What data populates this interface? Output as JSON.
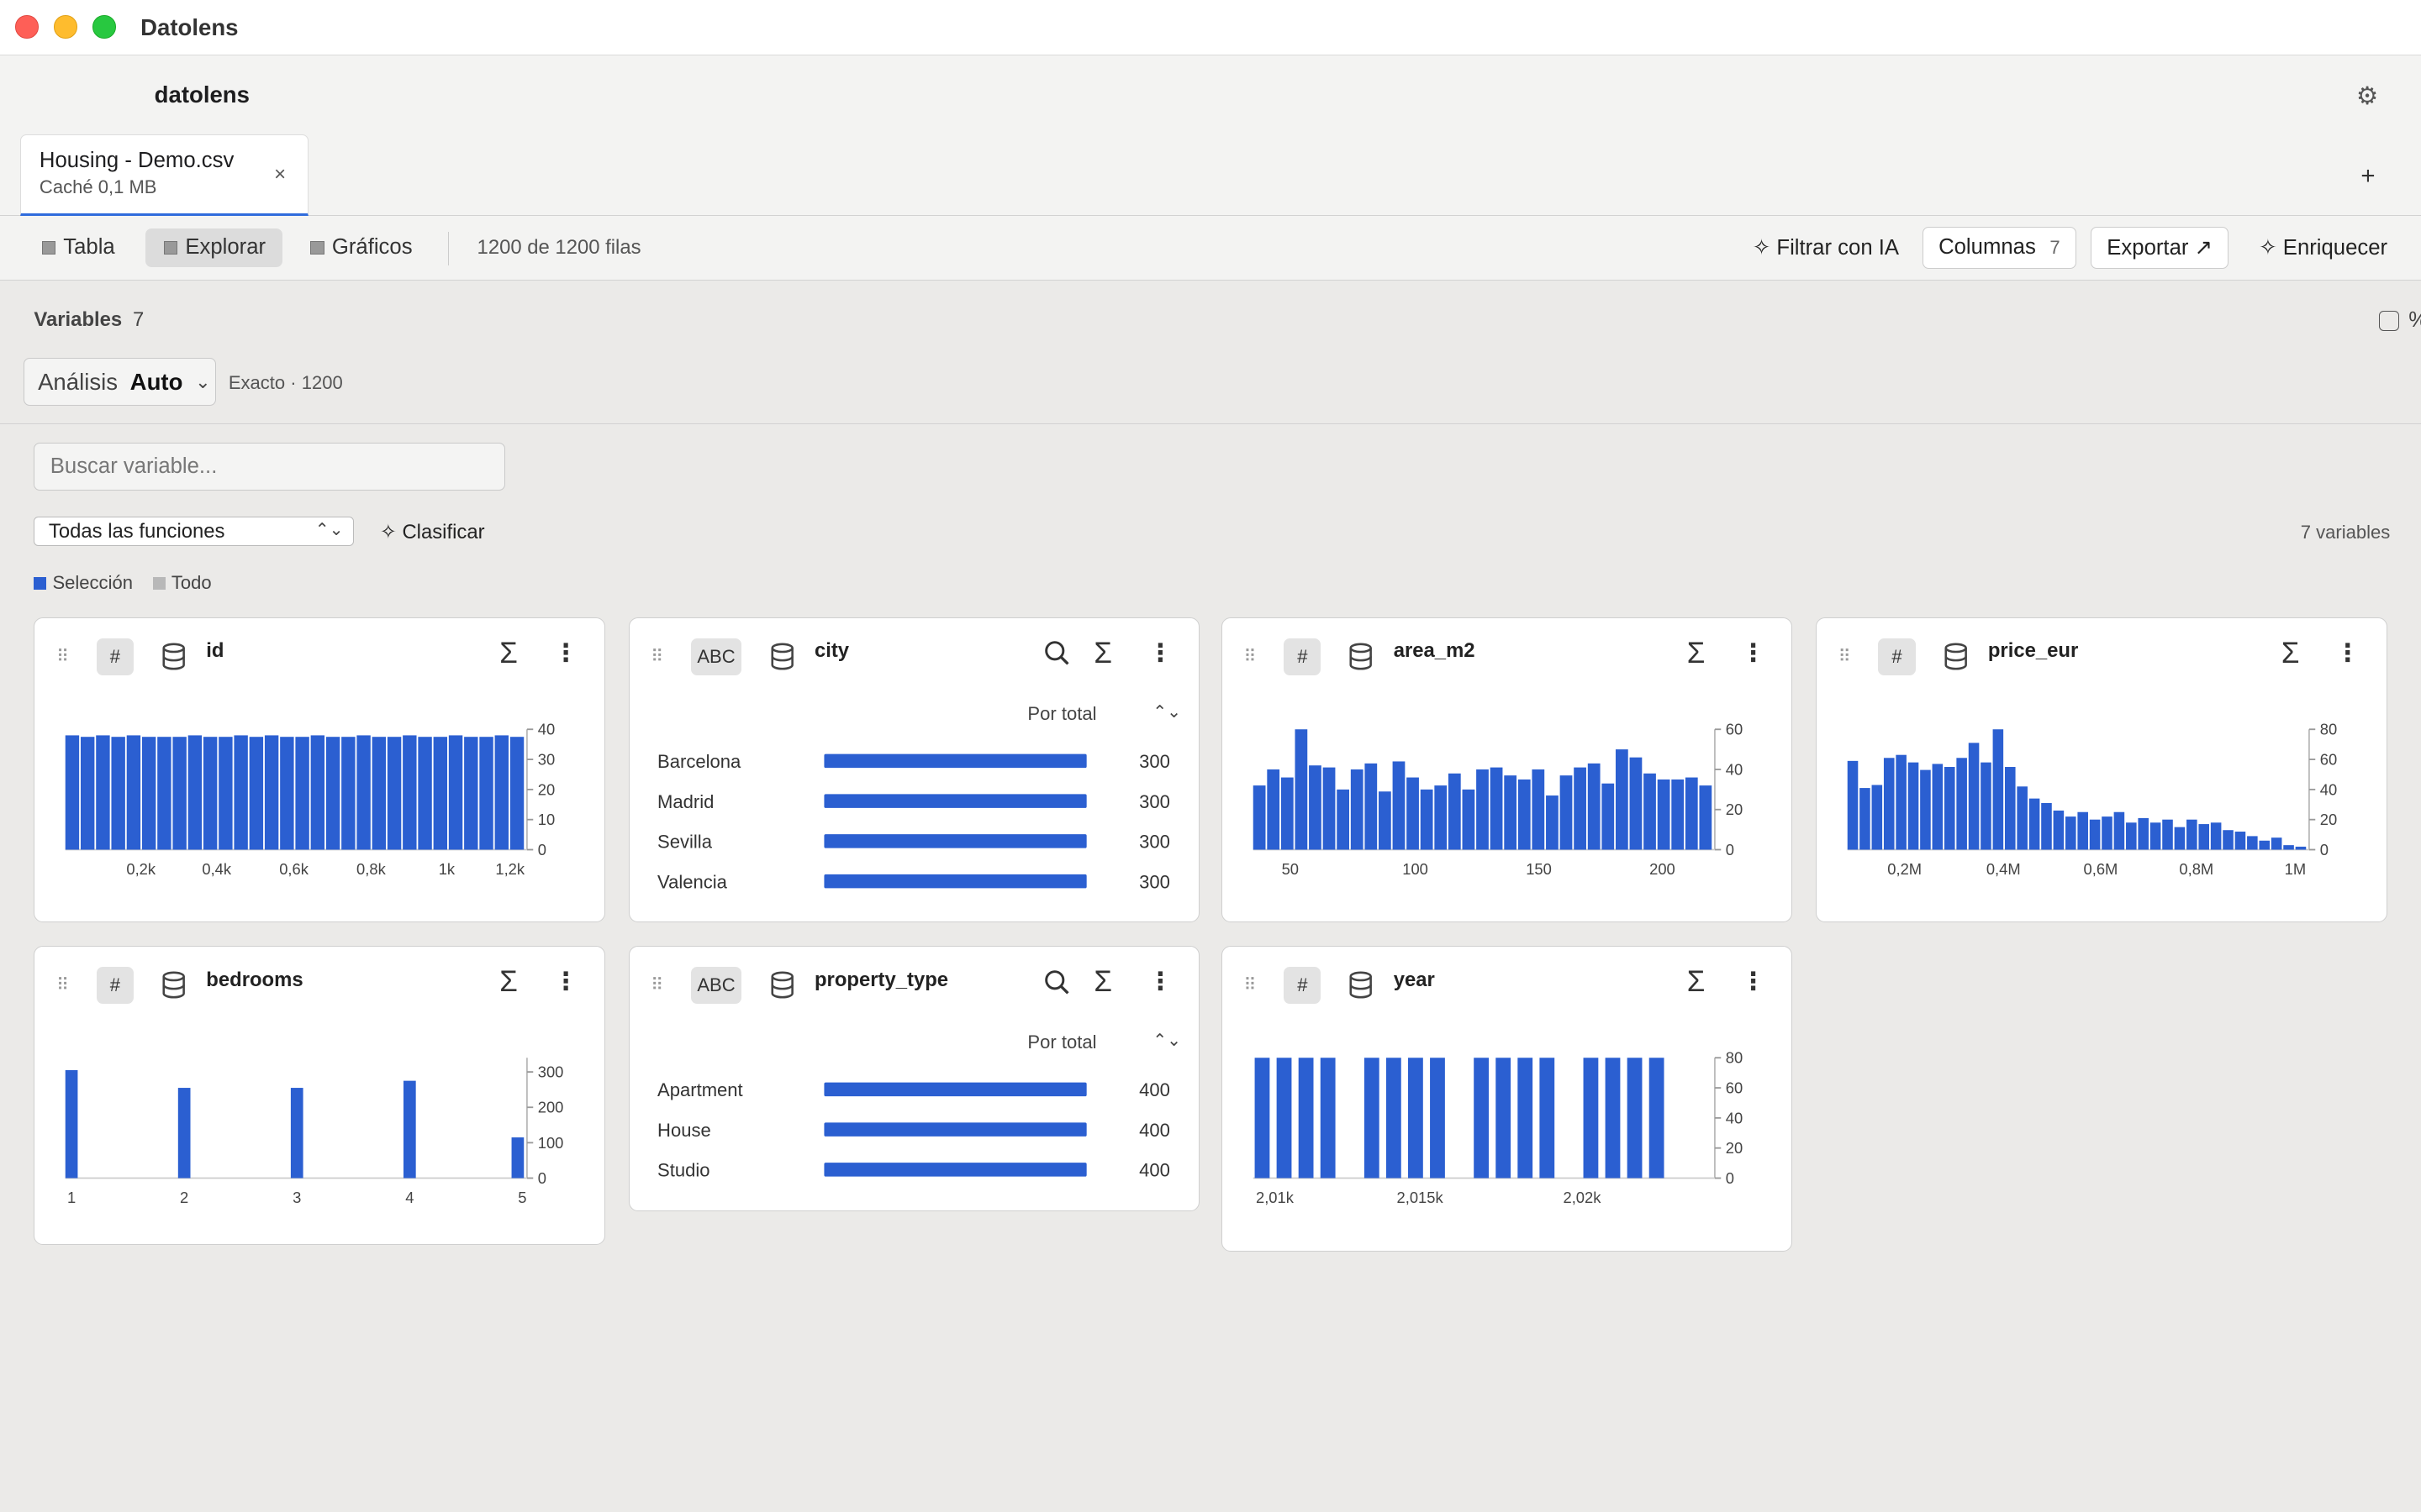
{
  "window": {
    "title": "Datolens"
  },
  "app": {
    "brand": "datolens",
    "settings_icon": "gear-icon"
  },
  "tab": {
    "name": "Housing - Demo.csv",
    "subtitle": "Caché 0,1 MB",
    "close": "×",
    "add": "+"
  },
  "toolbar": {
    "views": [
      "Tabla",
      "Explorar",
      "Gráficos"
    ],
    "active_view": "Explorar",
    "rows": "1200 de 1200 filas",
    "filter_ai": "✧ Filtrar con IA",
    "columns": "Columnas",
    "columns_count": "7",
    "export": "Exportar ↗",
    "enrich": "✧ Enriquecer"
  },
  "variables": {
    "label": "Variables",
    "count": "7",
    "percent_label": "%",
    "analysis_label": "Análisis",
    "analysis_value": "Auto",
    "exact": "Exacto · 1200",
    "search_placeholder": "Buscar variable...",
    "function_select": "Todas las funciones",
    "classify": "✧ Clasificar",
    "total": "7 variables",
    "legend": {
      "selection": "Selección",
      "all": "Todo"
    }
  },
  "colors": {
    "accent": "#2b5fd1",
    "bar": "#2b5fd1",
    "muted": "#b8b8b8"
  },
  "cards": [
    {
      "name": "id",
      "type": "#",
      "kind": "histogram"
    },
    {
      "name": "city",
      "type": "ABC",
      "kind": "categorical",
      "sort": "Por total"
    },
    {
      "name": "area_m2",
      "type": "#",
      "kind": "histogram"
    },
    {
      "name": "price_eur",
      "type": "#",
      "kind": "histogram"
    },
    {
      "name": "bedrooms",
      "type": "#",
      "kind": "histogram"
    },
    {
      "name": "property_type",
      "type": "ABC",
      "kind": "categorical",
      "sort": "Por total"
    },
    {
      "name": "year",
      "type": "#",
      "kind": "histogram"
    }
  ],
  "chart_data": [
    {
      "type": "bar",
      "variable": "id",
      "values": [
        38,
        37.5,
        38,
        37.5,
        38,
        37.5,
        37.5,
        37.5,
        38,
        37.5,
        37.5,
        38,
        37.5,
        38,
        37.5,
        37.5,
        38,
        37.5,
        37.5,
        38,
        37.5,
        37.5,
        38,
        37.5,
        37.5,
        38,
        37.5,
        37.5,
        38,
        37.5
      ],
      "x_ticks": [
        "0,2k",
        "0,4k",
        "0,6k",
        "0,8k",
        "1k",
        "1,2k"
      ],
      "y_ticks": [
        "0",
        "10",
        "20",
        "30",
        "40"
      ],
      "ylim": [
        0,
        40
      ]
    },
    {
      "type": "bar",
      "variable": "city",
      "categories": [
        "Barcelona",
        "Madrid",
        "Sevilla",
        "Valencia"
      ],
      "values": [
        300,
        300,
        300,
        300
      ]
    },
    {
      "type": "bar",
      "variable": "area_m2",
      "values": [
        32,
        40,
        36,
        60,
        42,
        41,
        30,
        40,
        43,
        29,
        44,
        36,
        30,
        32,
        38,
        30,
        40,
        41,
        37,
        35,
        40,
        27,
        37,
        41,
        43,
        33,
        50,
        46,
        38,
        35,
        35,
        36,
        32
      ],
      "x_ticks": [
        "50",
        "100",
        "150",
        "200"
      ],
      "y_ticks": [
        "0",
        "20",
        "40",
        "60"
      ],
      "ylim": [
        0,
        60
      ]
    },
    {
      "type": "bar",
      "variable": "price_eur",
      "values": [
        59,
        41,
        43,
        61,
        63,
        58,
        53,
        57,
        55,
        61,
        71,
        58,
        80,
        55,
        42,
        34,
        31,
        26,
        22,
        25,
        20,
        22,
        25,
        18,
        21,
        18,
        20,
        15,
        20,
        17,
        18,
        13,
        12,
        9,
        6,
        8,
        3,
        2
      ],
      "x_ticks": [
        "0,2M",
        "0,4M",
        "0,6M",
        "0,8M",
        "1M"
      ],
      "y_ticks": [
        "0",
        "20",
        "40",
        "60",
        "80"
      ],
      "ylim": [
        0,
        80
      ]
    },
    {
      "type": "bar",
      "variable": "bedrooms",
      "categories": [
        "1",
        "2",
        "3",
        "4",
        "5"
      ],
      "values": [
        305,
        255,
        255,
        275,
        115
      ],
      "x_ticks": [
        "1",
        "2",
        "3",
        "4",
        "5"
      ],
      "y_ticks": [
        "0",
        "100",
        "200",
        "300"
      ],
      "ylim": [
        0,
        340
      ]
    },
    {
      "type": "bar",
      "variable": "property_type",
      "categories": [
        "Apartment",
        "House",
        "Studio"
      ],
      "values": [
        400,
        400,
        400
      ]
    },
    {
      "type": "bar",
      "variable": "year",
      "values": [
        80,
        80,
        80,
        80,
        80,
        80,
        80,
        80,
        80,
        80,
        80,
        80,
        80,
        80,
        80,
        80
      ],
      "x_ticks": [
        "2,01k",
        "2,015k",
        "2,02k"
      ],
      "y_ticks": [
        "0",
        "20",
        "40",
        "60",
        "80"
      ],
      "ylim": [
        0,
        80
      ]
    }
  ]
}
